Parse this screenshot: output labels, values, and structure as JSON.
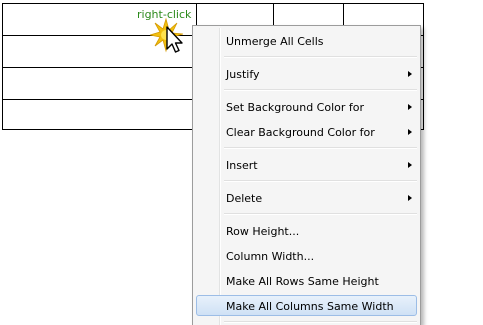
{
  "hint_text": "right-click",
  "cursor": {
    "icon": "arrow-cursor-icon",
    "burst_icon": "click-burst-icon"
  },
  "context_menu": {
    "items": {
      "unmerge": {
        "label": "Unmerge All Cells"
      },
      "justify": {
        "label": "Justify",
        "submenu": true
      },
      "set_bg": {
        "label": "Set Background Color for",
        "submenu": true
      },
      "clear_bg": {
        "label": "Clear Background Color for",
        "submenu": true
      },
      "insert": {
        "label": "Insert",
        "submenu": true
      },
      "delete": {
        "label": "Delete",
        "submenu": true
      },
      "row_height": {
        "label": "Row Height..."
      },
      "column_width": {
        "label": "Column Width..."
      },
      "same_height": {
        "label": "Make All Rows Same Height"
      },
      "same_width": {
        "label": "Make All Columns Same Width",
        "highlighted": true
      }
    }
  }
}
